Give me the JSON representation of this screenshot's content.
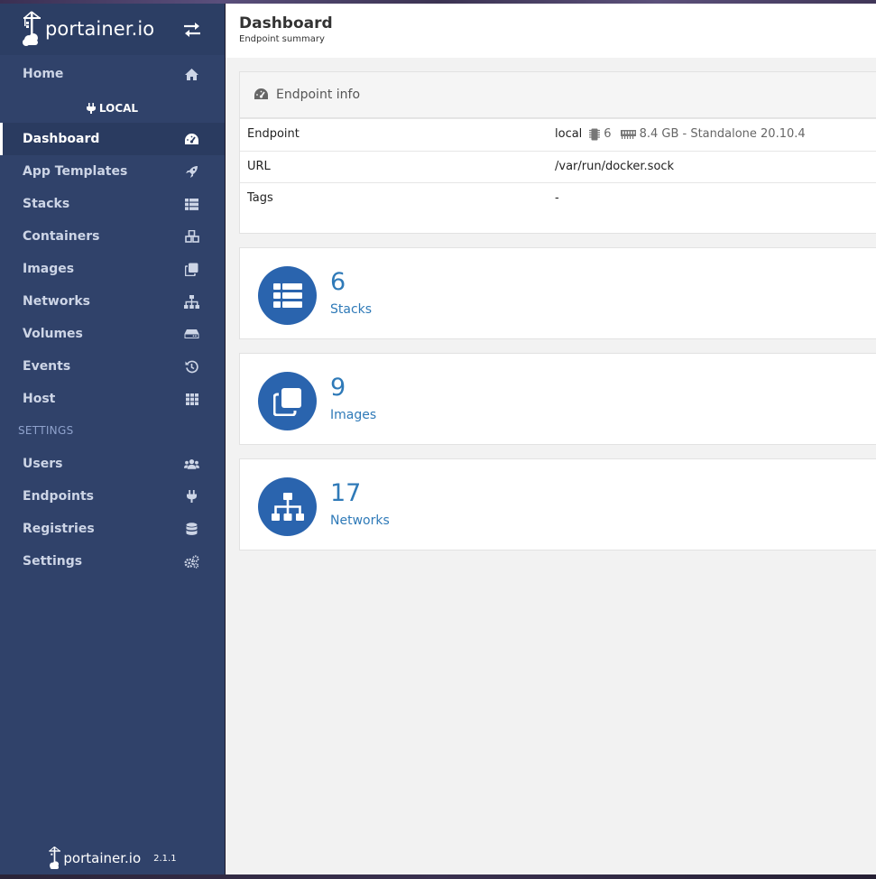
{
  "app": {
    "logo_text": "portainer.io",
    "version": "2.1.1"
  },
  "sidebar": {
    "endpoint_badge": "LOCAL",
    "settings_heading": "SETTINGS",
    "home": {
      "label": "Home",
      "icon": "home-icon"
    },
    "items": [
      {
        "label": "Dashboard",
        "icon": "tachometer-icon",
        "active": true
      },
      {
        "label": "App Templates",
        "icon": "rocket-icon"
      },
      {
        "label": "Stacks",
        "icon": "th-list-icon"
      },
      {
        "label": "Containers",
        "icon": "cubes-icon"
      },
      {
        "label": "Images",
        "icon": "clone-icon"
      },
      {
        "label": "Networks",
        "icon": "sitemap-icon"
      },
      {
        "label": "Volumes",
        "icon": "hdd-icon"
      },
      {
        "label": "Events",
        "icon": "history-icon"
      },
      {
        "label": "Host",
        "icon": "th-icon"
      }
    ],
    "settings_items": [
      {
        "label": "Users",
        "icon": "users-icon"
      },
      {
        "label": "Endpoints",
        "icon": "plug-icon"
      },
      {
        "label": "Registries",
        "icon": "database-icon"
      },
      {
        "label": "Settings",
        "icon": "cogs-icon"
      }
    ]
  },
  "header": {
    "title": "Dashboard",
    "subtitle": "Endpoint summary"
  },
  "endpoint_info": {
    "title": "Endpoint info",
    "rows": [
      {
        "key": "Endpoint",
        "value": "local",
        "cpu": "6",
        "memory": "8.4 GB - Standalone 20.10.4"
      },
      {
        "key": "URL",
        "value": "/var/run/docker.sock"
      },
      {
        "key": "Tags",
        "value": "-"
      }
    ]
  },
  "stats": [
    {
      "count": "6",
      "label": "Stacks",
      "icon": "th-list-icon"
    },
    {
      "count": "9",
      "label": "Images",
      "icon": "clone-icon"
    },
    {
      "count": "17",
      "label": "Networks",
      "icon": "sitemap-icon"
    }
  ],
  "colors": {
    "sidebar": "#30426a",
    "accent": "#2a64ae",
    "stat_text": "#2f7ab8"
  }
}
